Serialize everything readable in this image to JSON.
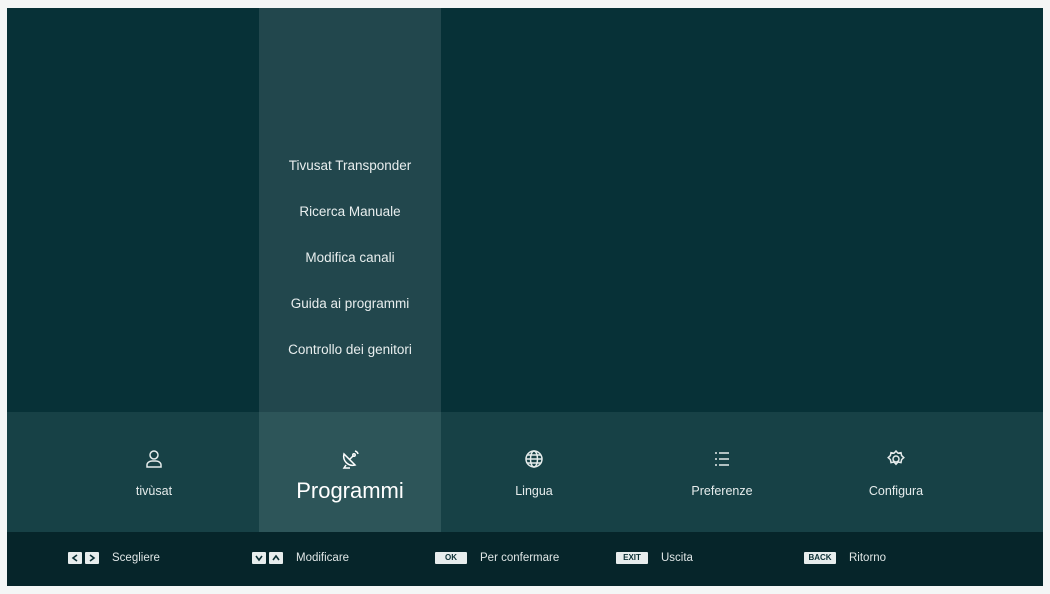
{
  "submenu": {
    "items": [
      {
        "label": "Tivusat Transponder"
      },
      {
        "label": "Ricerca Manuale"
      },
      {
        "label": "Modifica canali"
      },
      {
        "label": "Guida ai programmi"
      },
      {
        "label": "Controllo dei genitori"
      }
    ]
  },
  "main_menu": {
    "items": [
      {
        "label": "tivùsat",
        "icon": "user-icon"
      },
      {
        "label": "Programmi",
        "icon": "satellite-dish-icon",
        "active": true
      },
      {
        "label": "Lingua",
        "icon": "globe-icon"
      },
      {
        "label": "Preferenze",
        "icon": "list-icon"
      },
      {
        "label": "Configura",
        "icon": "gear-icon"
      }
    ]
  },
  "hints": [
    {
      "keys": [
        "left-arrow-key",
        "right-arrow-key"
      ],
      "label": "Scegliere"
    },
    {
      "keys": [
        "down-arrow-key",
        "up-arrow-key"
      ],
      "label": "Modificare"
    },
    {
      "key_text": "OK",
      "label": "Per confermare"
    },
    {
      "key_text": "EXIT",
      "label": "Uscita"
    },
    {
      "key_text": "BACK",
      "label": "Ritorno"
    }
  ],
  "colors": {
    "background": "#073137",
    "submenu_panel": "#22474d",
    "main_bar": "#174146",
    "active_item": "#2d5559",
    "hint_bar": "#06252a"
  }
}
